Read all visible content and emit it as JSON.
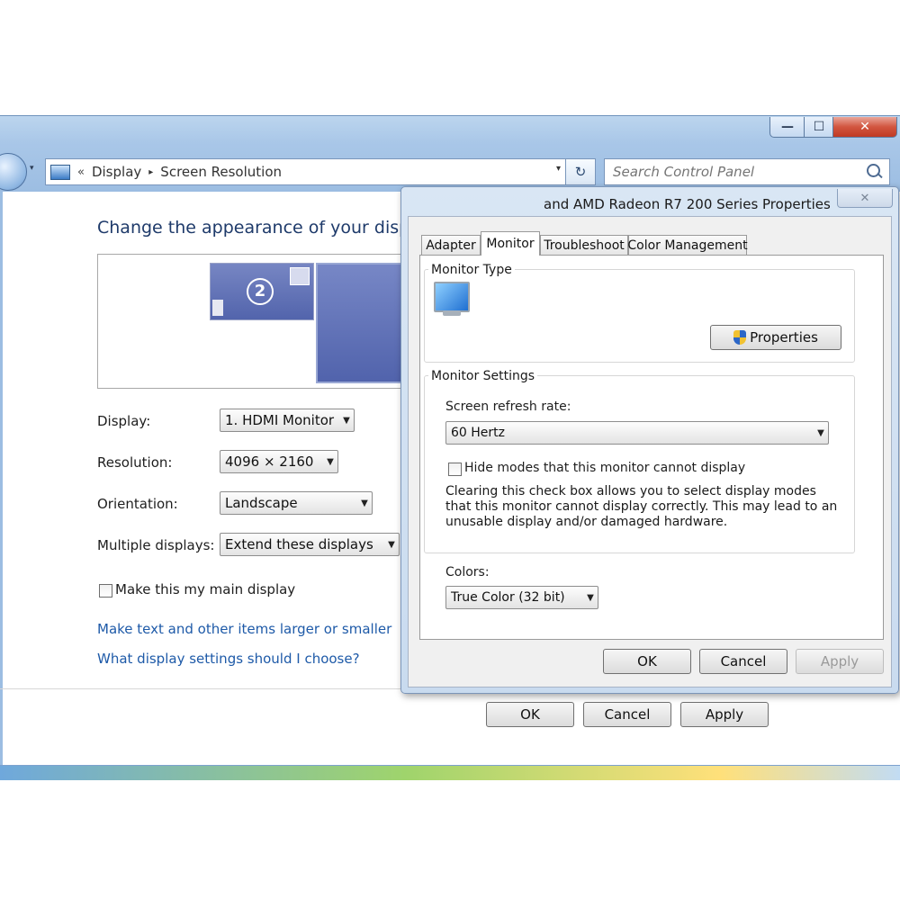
{
  "main_window": {
    "caption_buttons": {
      "minimize": "—",
      "maximize": "☐",
      "close": "✕"
    },
    "address": {
      "chevron": "«",
      "crumbs": [
        "Display",
        "Screen Resolution"
      ],
      "separator": "▸",
      "dropdown": "▾"
    },
    "refresh_glyph": "↻",
    "search": {
      "placeholder": "Search Control Panel"
    },
    "title": "Change the appearance of your displays",
    "preview": {
      "monitor_2_number": "2"
    },
    "fields": {
      "display_label": "Display:",
      "display_value": "1. HDMI Monitor",
      "resolution_label": "Resolution:",
      "resolution_value": "4096 × 2160",
      "orientation_label": "Orientation:",
      "orientation_value": "Landscape",
      "multiple_label": "Multiple displays:",
      "multiple_value": "Extend these displays"
    },
    "main_display_checkbox": "Make this my main display",
    "links": {
      "text_size": "Make text and other items larger or smaller",
      "choose": "What display settings should I choose?"
    },
    "buttons": {
      "ok": "OK",
      "cancel": "Cancel",
      "apply": "Apply"
    }
  },
  "dialog": {
    "title": "and AMD Radeon R7 200 Series Properties",
    "close_glyph": "✕",
    "tabs": [
      "Adapter",
      "Monitor",
      "Troubleshoot",
      "Color Management"
    ],
    "active_tab": "Monitor",
    "monitor_type_label": "Monitor Type",
    "properties_button": "Properties",
    "monitor_settings_label": "Monitor Settings",
    "refresh_rate_label": "Screen refresh rate:",
    "refresh_rate_value": "60 Hertz",
    "hide_modes_label": "Hide modes that this monitor cannot display",
    "warning_text": "Clearing this check box allows you to select display modes that this monitor cannot display correctly. This may lead to an unusable display and/or damaged hardware.",
    "colors_label": "Colors:",
    "colors_value": "True Color (32 bit)",
    "buttons": {
      "ok": "OK",
      "cancel": "Cancel",
      "apply": "Apply"
    }
  },
  "dropdown_arrow": "▼",
  "colors": {
    "link": "#1e5aa8",
    "title": "#1e3a6a",
    "monitor_preview": "#5a6cb0"
  }
}
